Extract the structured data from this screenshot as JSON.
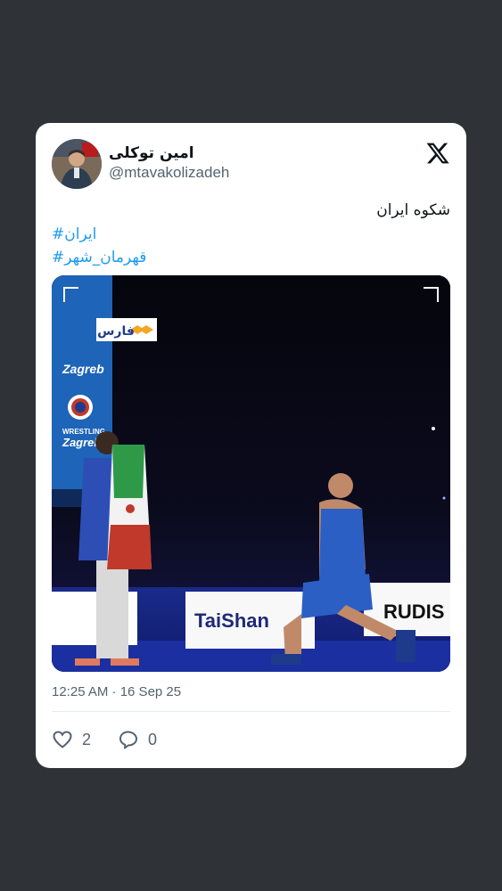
{
  "tweet": {
    "author": {
      "display_name": "امین توکلی",
      "handle": "@mtavakolizadeh"
    },
    "text": "شکوه ایران",
    "hashtags": [
      "ایران#",
      "قهرمان_شهر#"
    ],
    "timestamp": "12:25 AM · 16 Sep 25",
    "media": {
      "watermark": "فارس",
      "sponsor_banner": "TaiShan",
      "sponsor_banner_2": "RUDIS",
      "event_banner": "Zagreb",
      "event_label": "WRESTLING"
    },
    "stats": {
      "likes": "2",
      "replies": "0"
    }
  },
  "colors": {
    "background": "#2f3337",
    "card": "#ffffff",
    "link": "#1d9bf0",
    "muted": "#536471"
  },
  "icons": [
    "x-logo-icon",
    "heart-icon",
    "reply-icon"
  ]
}
